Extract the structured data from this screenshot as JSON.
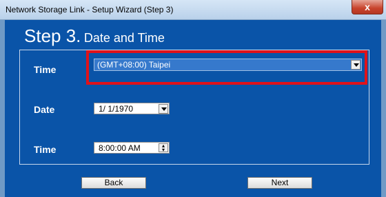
{
  "window": {
    "title": "Network Storage Link - Setup Wizard (Step 3)",
    "close_glyph": "x"
  },
  "heading": {
    "step": "Step 3.",
    "subtitle": "Date and Time"
  },
  "form": {
    "timezone_label": "Time",
    "timezone_value": "(GMT+08:00) Taipei",
    "date_label": "Date",
    "date_value": "1/ 1/1970",
    "time_label": "Time",
    "time_value": "8:00:00 AM"
  },
  "buttons": {
    "back": "Back",
    "next": "Next"
  },
  "colors": {
    "client_bg": "#0a54a8",
    "highlight": "#e0121a",
    "selected_bg": "#3679cc"
  },
  "icons": {
    "close": "close-icon",
    "dropdown": "chevron-down-icon",
    "spinner": "spinner-icon"
  }
}
